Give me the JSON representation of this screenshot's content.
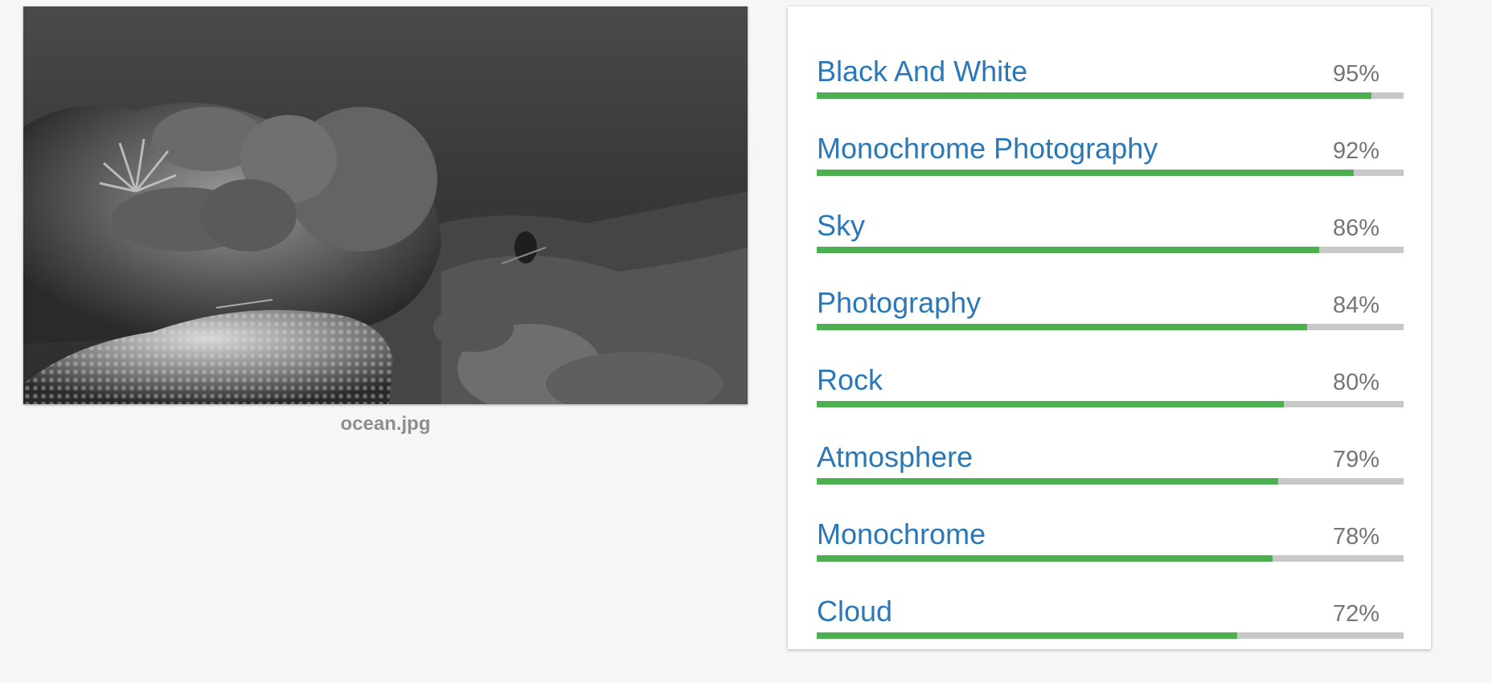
{
  "image": {
    "filename": "ocean.jpg",
    "description_icon": "image-photo"
  },
  "labels": [
    {
      "name": "Black And White",
      "score_text": "95%",
      "score": 0.95
    },
    {
      "name": "Monochrome Photography",
      "score_text": "92%",
      "score": 0.92
    },
    {
      "name": "Sky",
      "score_text": "86%",
      "score": 0.86
    },
    {
      "name": "Photography",
      "score_text": "84%",
      "score": 0.84
    },
    {
      "name": "Rock",
      "score_text": "80%",
      "score": 0.8
    },
    {
      "name": "Atmosphere",
      "score_text": "79%",
      "score": 0.79
    },
    {
      "name": "Monochrome",
      "score_text": "78%",
      "score": 0.78
    },
    {
      "name": "Cloud",
      "score_text": "72%",
      "score": 0.72
    }
  ],
  "colors": {
    "label_text": "#2a78b8",
    "score_text": "#757575",
    "bar_fill": "#4caf50",
    "bar_track": "#c8c8c8",
    "caption": "#8e8e8e",
    "background": "#f6f6f6"
  }
}
